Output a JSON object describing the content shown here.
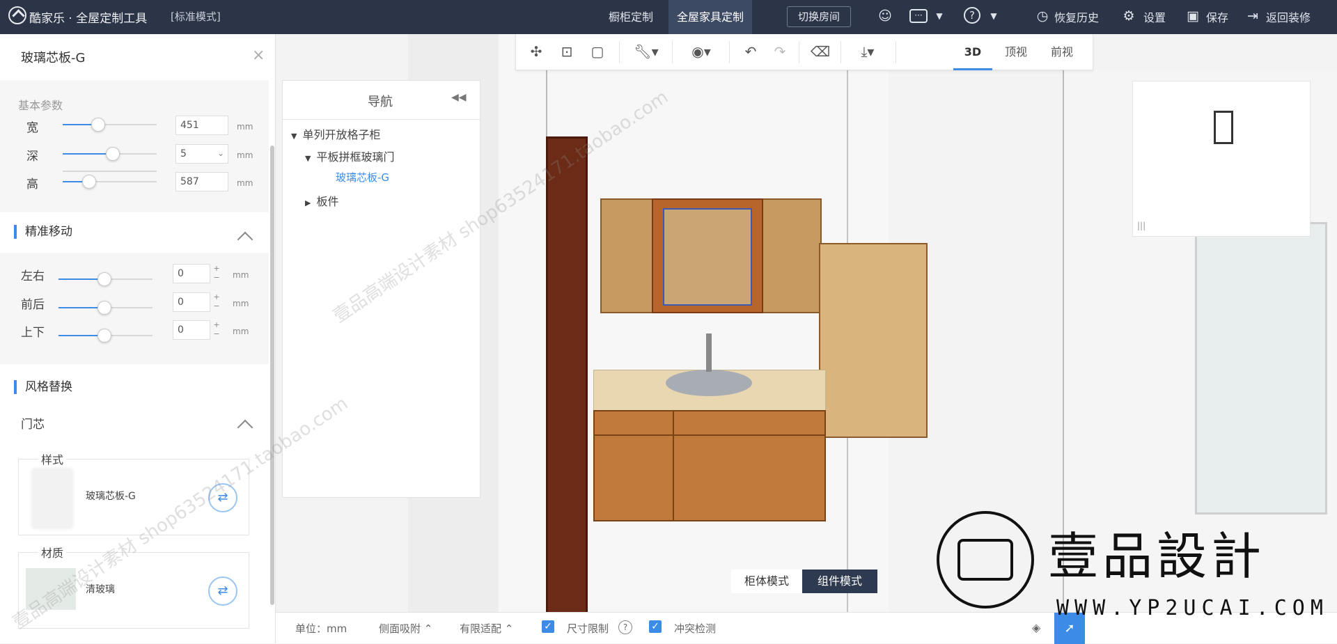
{
  "app": {
    "title": "酷家乐 · 全屋定制工具",
    "mode": "[标准模式]",
    "tabs": [
      {
        "label": "橱柜定制",
        "active": false
      },
      {
        "label": "全屋家具定制",
        "active": true
      }
    ],
    "switch_room": "切换房间",
    "links": {
      "history": "恢复历史",
      "settings": "设置",
      "save": "保存",
      "back": "返回装修"
    }
  },
  "left": {
    "title": "玻璃芯板-G",
    "basic": {
      "label": "基本参数",
      "rows": [
        {
          "label": "宽",
          "value": "451",
          "unit": "mm",
          "level": 0.3
        },
        {
          "label": "深",
          "value": "5",
          "unit": "mm",
          "level": 0.5
        },
        {
          "label": "高",
          "value": "587",
          "unit": "mm",
          "level": 0.3
        }
      ]
    },
    "move": {
      "label": "精准移动",
      "rows": [
        {
          "label": "左右",
          "value": "0",
          "unit": "mm"
        },
        {
          "label": "前后",
          "value": "0",
          "unit": "mm"
        },
        {
          "label": "上下",
          "value": "0",
          "unit": "mm"
        }
      ]
    },
    "style": {
      "label": "风格替换",
      "door": "门芯",
      "style_card": {
        "tag": "样式",
        "name": "玻璃芯板-G"
      },
      "material_card": {
        "tag": "材质",
        "name": "清玻璃"
      }
    }
  },
  "nav": {
    "title": "导航",
    "tree": [
      {
        "label": "单列开放格子柜"
      },
      {
        "label": "平板拼框玻璃门"
      },
      {
        "label": "玻璃芯板-G"
      },
      {
        "label": "板件"
      }
    ]
  },
  "toolbar": {
    "views": [
      "3D",
      "顶视",
      "前视"
    ]
  },
  "modes": {
    "cabinet": "柜体模式",
    "component": "组件模式"
  },
  "bottom": {
    "unit": "单位：mm",
    "side": "侧面吸附",
    "fit": "有限适配",
    "size_limit": "尺寸限制",
    "collision": "冲突检测"
  },
  "brand": {
    "name": "壹品設計",
    "url": "WWW.YP2UCAI.COM"
  },
  "watermarks": {
    "a": "壹品高端设计素材 shop63524171.taobao.com",
    "b": "壹品高端设计素材 shop63524171.taobao.com"
  }
}
